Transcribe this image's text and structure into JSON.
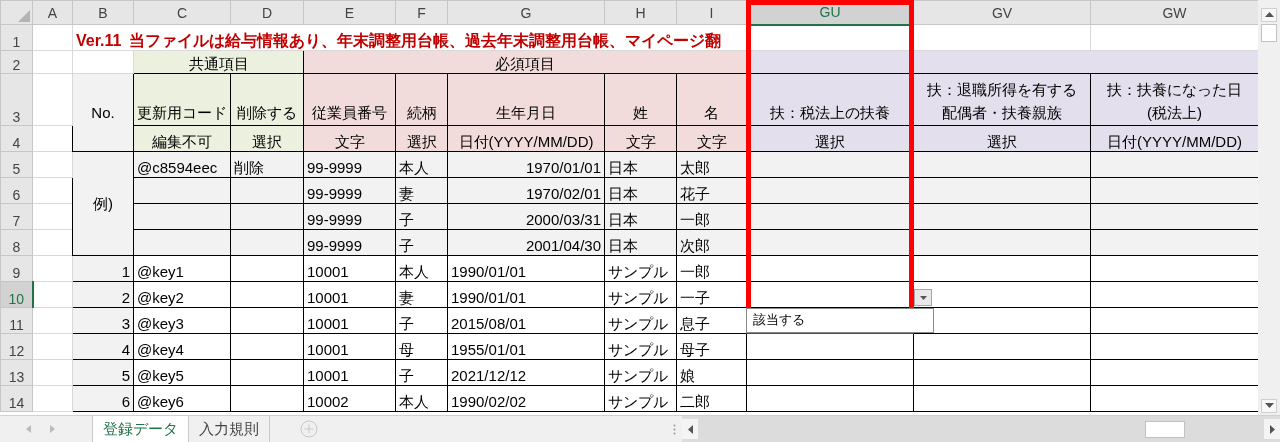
{
  "column_headers": [
    {
      "label": "A",
      "selected": false
    },
    {
      "label": "B",
      "selected": false
    },
    {
      "label": "C",
      "selected": false
    },
    {
      "label": "D",
      "selected": false
    },
    {
      "label": "E",
      "selected": false
    },
    {
      "label": "F",
      "selected": false
    },
    {
      "label": "G",
      "selected": false
    },
    {
      "label": "H",
      "selected": false
    },
    {
      "label": "I",
      "selected": false
    },
    {
      "label": "GU",
      "selected": true
    },
    {
      "label": "GV",
      "selected": false
    },
    {
      "label": "GW",
      "selected": false
    }
  ],
  "row_headers": [
    {
      "label": "1",
      "selected": false
    },
    {
      "label": "2",
      "selected": false
    },
    {
      "label": "3",
      "selected": false
    },
    {
      "label": "4",
      "selected": false
    },
    {
      "label": "5",
      "selected": false
    },
    {
      "label": "6",
      "selected": false
    },
    {
      "label": "7",
      "selected": false
    },
    {
      "label": "8",
      "selected": false
    },
    {
      "label": "9",
      "selected": false
    },
    {
      "label": "10",
      "selected": true
    },
    {
      "label": "11",
      "selected": false
    },
    {
      "label": "12",
      "selected": false
    },
    {
      "label": "13",
      "selected": false
    },
    {
      "label": "14",
      "selected": false
    }
  ],
  "title_banner": {
    "version": "Ver.11",
    "text": "当ファイルは給与情報あり、年末調整用台帳、過去年末調整用台帳、マイページ翻"
  },
  "group_headers": [
    {
      "label": "共通項目",
      "kind": "common"
    },
    {
      "label": "必須項目",
      "kind": "required"
    },
    {
      "kind": "dependent"
    }
  ],
  "no_header": "No.",
  "column_titles": [
    [
      "更新用コード"
    ],
    [
      "削除する"
    ],
    [
      "従業員番号"
    ],
    [
      "続柄"
    ],
    [
      "生年月日"
    ],
    [
      "姓"
    ],
    [
      "名"
    ],
    [
      "扶：税法上の扶養"
    ],
    [
      "扶：退職所得を有する",
      "配偶者・扶養親族"
    ],
    [
      "扶：扶養になった日",
      "(税法上)"
    ]
  ],
  "column_types": [
    "編集不可",
    "選択",
    "文字",
    "選択",
    "日付(YYYY/MM/DD)",
    "文字",
    "文字",
    "選択",
    "選択",
    "日付(YYYY/MM/DD)"
  ],
  "example_label": "例)",
  "example_rows": [
    {
      "c": "@c8594eec",
      "d": "削除",
      "e": "99-9999",
      "f": "本人",
      "g": "1970/01/01",
      "h": "日本",
      "i": "太郎"
    },
    {
      "e": "99-9999",
      "f": "妻",
      "g": "1970/02/01",
      "h": "日本",
      "i": "花子"
    },
    {
      "e": "99-9999",
      "f": "子",
      "g": "2000/03/31",
      "h": "日本",
      "i": "一郎"
    },
    {
      "e": "99-9999",
      "f": "子",
      "g": "2001/04/30",
      "h": "日本",
      "i": "次郎"
    }
  ],
  "rows": [
    {
      "no": "1",
      "c": "@key1",
      "e": "10001",
      "f": "本人",
      "g": "1990/01/01",
      "h": "サンプル",
      "i": "一郎"
    },
    {
      "no": "2",
      "c": "@key2",
      "e": "10001",
      "f": "妻",
      "g": "1990/01/01",
      "h": "サンプル",
      "i": "一子"
    },
    {
      "no": "3",
      "c": "@key3",
      "e": "10001",
      "f": "子",
      "g": "2015/08/01",
      "h": "サンプル",
      "i": "息子"
    },
    {
      "no": "4",
      "c": "@key4",
      "e": "10001",
      "f": "母",
      "g": "1955/01/01",
      "h": "サンプル",
      "i": "母子"
    },
    {
      "no": "5",
      "c": "@key5",
      "e": "10001",
      "f": "子",
      "g": "2021/12/12",
      "h": "サンプル",
      "i": "娘"
    },
    {
      "no": "6",
      "c": "@key6",
      "e": "10002",
      "f": "本人",
      "g": "1990/02/02",
      "h": "サンプル",
      "i": "二郎"
    }
  ],
  "dropdown": {
    "options": [
      "該当する"
    ]
  },
  "sheet_tabs": [
    {
      "label": "登録データ",
      "selected": true
    },
    {
      "label": "入力規則",
      "selected": false
    }
  ]
}
